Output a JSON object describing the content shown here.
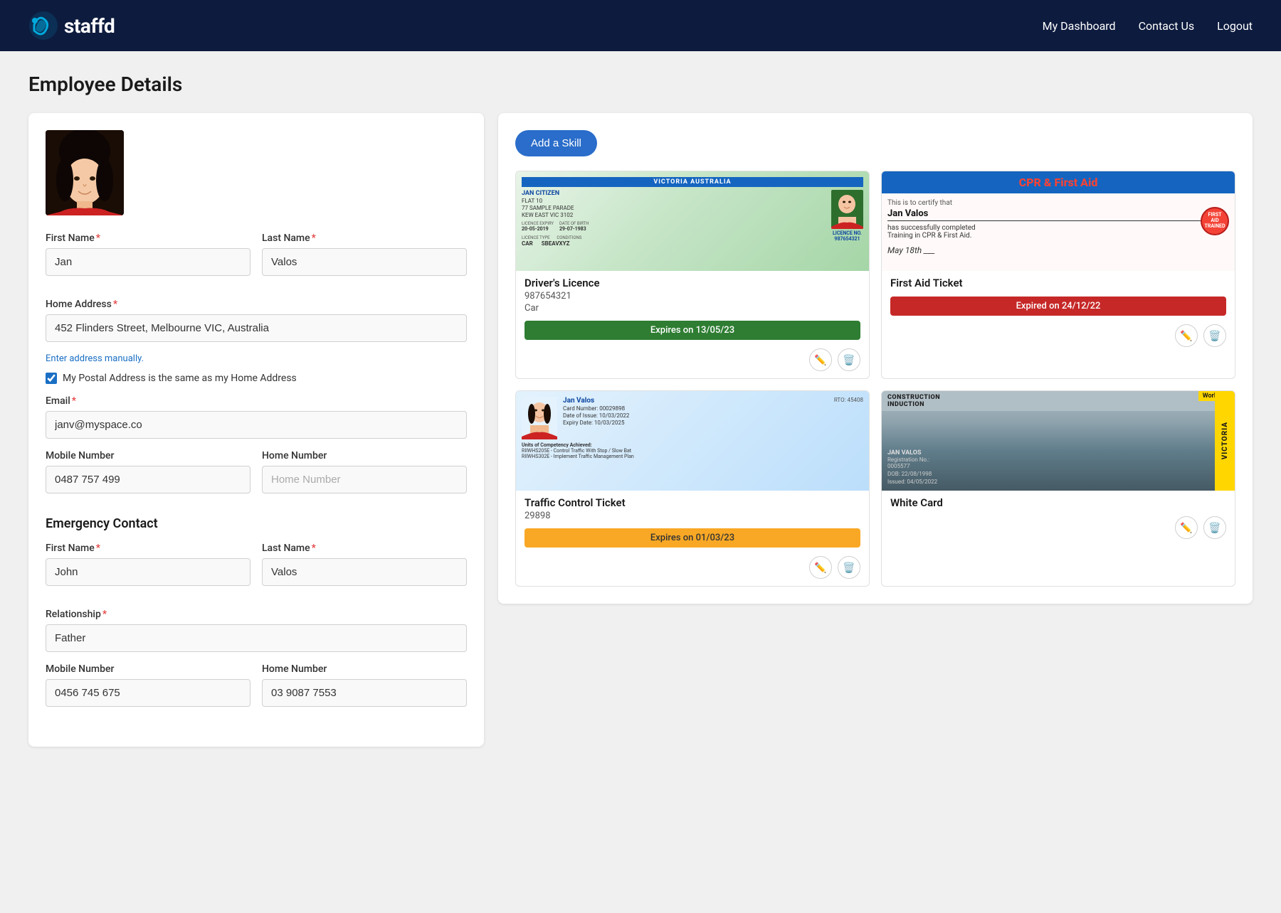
{
  "header": {
    "logo_text": "staffd",
    "nav": {
      "dashboard": "My Dashboard",
      "contact": "Contact Us",
      "logout": "Logout"
    }
  },
  "page": {
    "title": "Employee Details"
  },
  "form": {
    "first_name_label": "First Name",
    "first_name_value": "Jan",
    "last_name_label": "Last Name",
    "last_name_value": "Valos",
    "home_address_label": "Home Address",
    "home_address_value": "452 Flinders Street, Melbourne VIC, Australia",
    "address_manual_link": "Enter address manually.",
    "postal_checkbox_label": "My Postal Address is the same as my Home Address",
    "email_label": "Email",
    "email_value": "janv@myspace.co",
    "mobile_number_label": "Mobile Number",
    "mobile_number_value": "0487 757 499",
    "home_number_label": "Home Number",
    "home_number_placeholder": "Home Number",
    "emergency_title": "Emergency Contact",
    "emergency_first_name_label": "First Name",
    "emergency_first_name_value": "John",
    "emergency_last_name_label": "Last Name",
    "emergency_last_name_value": "Valos",
    "relationship_label": "Relationship",
    "relationship_value": "Father",
    "emergency_mobile_label": "Mobile Number",
    "emergency_mobile_value": "0456 745 675",
    "emergency_home_label": "Home Number",
    "emergency_home_value": "03 9087 7553"
  },
  "skills": {
    "add_button": "Add a Skill",
    "cards": [
      {
        "id": "drivers-licence",
        "name": "Driver's Licence",
        "number": "987654321",
        "sub": "Car",
        "expiry_label": "Expires on 13/05/23",
        "expiry_status": "green"
      },
      {
        "id": "first-aid",
        "name": "First Aid Ticket",
        "number": "",
        "sub": "",
        "expiry_label": "Expired on 24/12/22",
        "expiry_status": "red"
      },
      {
        "id": "traffic-control",
        "name": "Traffic Control Ticket",
        "number": "29898",
        "sub": "",
        "expiry_label": "Expires on 01/03/23",
        "expiry_status": "yellow"
      },
      {
        "id": "white-card",
        "name": "White Card",
        "number": "",
        "sub": "",
        "expiry_label": "",
        "expiry_status": "none"
      }
    ]
  }
}
